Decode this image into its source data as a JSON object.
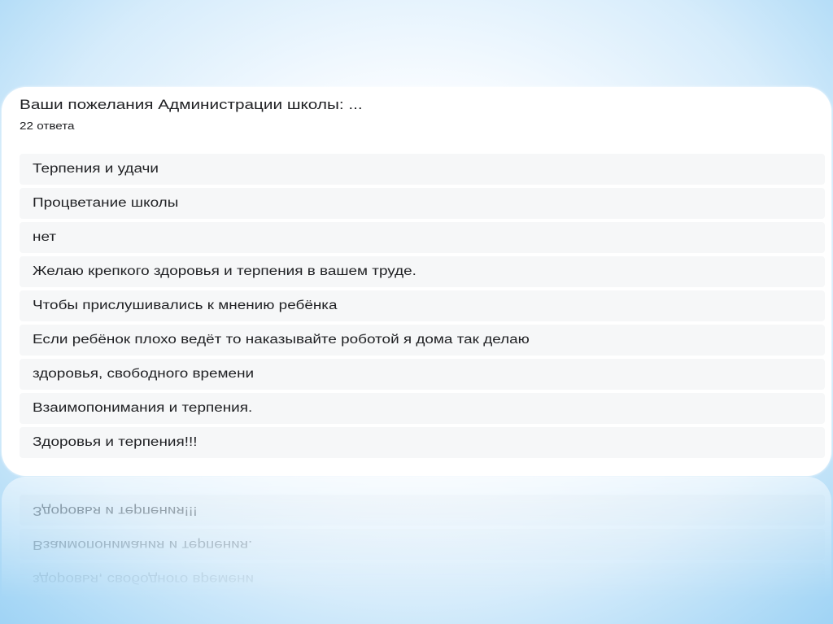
{
  "form": {
    "question": "Ваши пожелания Администрации школы: ...",
    "response_count": "22 ответа"
  },
  "responses": [
    "Терпения и удачи",
    "Процветание школы",
    "нет",
    "Желаю крепкого здоровья и терпения в вашем труде.",
    "Чтобы прислушивались к мнению ребёнка",
    "Если ребёнок плохо ведёт то наказывайте роботой я дома так делаю",
    "здоровья, свободного времени",
    "Взаимопонимания и терпения.",
    "Здоровья и терпения!!!"
  ],
  "colors": {
    "text": "#202124",
    "row_background": "#f6f7f8",
    "card_background": "#ffffff",
    "slide_edge_blue": "#93cdf3"
  }
}
